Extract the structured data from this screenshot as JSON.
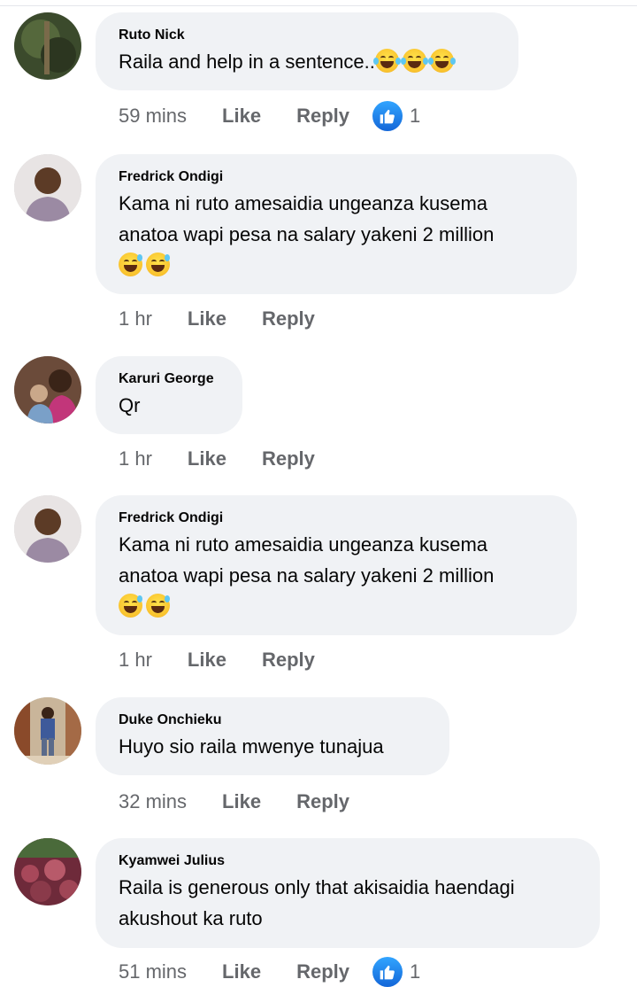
{
  "actions": {
    "like_label": "Like",
    "reply_label": "Reply"
  },
  "comments": [
    {
      "author": "Ruto Nick",
      "text": "Raila and help in a sentence..",
      "emoji": "laugh-tears",
      "emoji_count": 3,
      "time": "59 mins",
      "reaction_count": "1"
    },
    {
      "author": "Fredrick Ondigi",
      "text_lines": [
        "Kama ni ruto amesaidia ungeanza kusema",
        "anatoa wapi pesa na salary yakeni 2 million"
      ],
      "emoji": "grin-sweat",
      "emoji_count": 2,
      "time": "1 hr"
    },
    {
      "author": "Karuri George",
      "text": "Qr",
      "time": "1 hr"
    },
    {
      "author": "Fredrick Ondigi",
      "text_lines": [
        "Kama ni ruto amesaidia ungeanza kusema",
        "anatoa wapi pesa na salary yakeni 2 million"
      ],
      "emoji": "grin-sweat",
      "emoji_count": 2,
      "time": "1 hr"
    },
    {
      "author": "Duke Onchieku",
      "text": "Huyo sio raila mwenye tunajua",
      "time": "32 mins"
    },
    {
      "author": "Kyamwei Julius",
      "text_lines": [
        "Raila is generous only that akisaidia haendagi",
        "akushout ka ruto"
      ],
      "time": "51 mins",
      "reaction_count": "1"
    }
  ],
  "colors": {
    "bubble": "#f0f2f5",
    "meta_text": "#65676b",
    "like_blue": "#1877f2"
  },
  "icons": {
    "like_reaction": "thumbs-up-icon"
  }
}
